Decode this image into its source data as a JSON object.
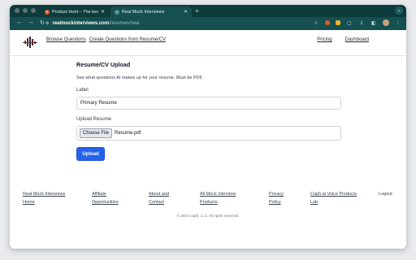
{
  "browser": {
    "tabs": [
      {
        "title": "Product Hunt – The best new",
        "favicon_color": "#e35b2b",
        "favicon_letter": "P"
      },
      {
        "title": "Real Mock Interviews",
        "favicon_color": "#4b8f8f",
        "favicon_letter": "+"
      }
    ],
    "address": {
      "host": "realmockinterviews.com",
      "path": "/resumes/new"
    }
  },
  "header": {
    "nav_left": [
      "Browse Questions",
      "Create Questions from Resume/CV"
    ],
    "nav_right": [
      "Pricing",
      "Dashboard"
    ]
  },
  "form": {
    "title": "Resume/CV Upload",
    "description": "See what questions AI makes up for your resume. Must be PDF.",
    "label_label": "Label",
    "label_value": "Primary Resume",
    "upload_label": "Upload Resume",
    "choose_file": "Choose File",
    "file_name": "Resume.pdf",
    "submit": "Upload"
  },
  "footer": {
    "links": [
      [
        "Real Mock Interviews",
        "Home"
      ],
      [
        "Affiliate",
        "Opportunities"
      ],
      [
        "About and",
        "Contact"
      ],
      [
        "All Mock Interview",
        "Products"
      ],
      [
        "Privacy",
        "Policy"
      ],
      [
        "Caph.ai Voice Products",
        "Lab"
      ]
    ],
    "logout": "Logout",
    "copyright": "© 2024 Caph, LLC. All rights reserved."
  },
  "colors": {
    "toolbar": "#164f4f",
    "tabstrip": "#0d3b3b",
    "primary_button": "#2563eb"
  }
}
